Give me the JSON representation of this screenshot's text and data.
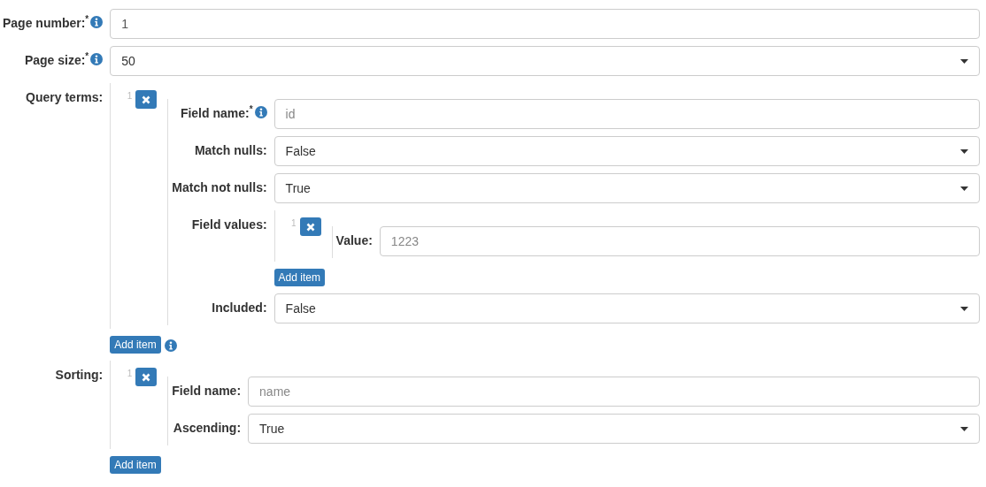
{
  "fields": [
    {
      "kind": "input",
      "label": "Page number:$^{*}$",
      "info": true,
      "value": "1"
    },
    {
      "kind": "select",
      "label": "Page size:$^{*}$",
      "info": true,
      "value": "50"
    },
    {
      "kind": "list",
      "label": "Query terms:",
      "add_button": "Add item",
      "add_info": true,
      "items": [
        {
          "index": "1",
          "fields": [
            {
              "kind": "input",
              "label": "Field name:$^{*}$",
              "info": true,
              "placeholder": "id"
            },
            {
              "kind": "select",
              "label": "Match nulls:",
              "value": "False"
            },
            {
              "kind": "select",
              "label": "Match not nulls:",
              "value": "True"
            },
            {
              "kind": "list",
              "label": "Field values:",
              "add_button": "Add item",
              "items": [
                {
                  "index": "1",
                  "fields": [
                    {
                      "kind": "input",
                      "label": "Value:",
                      "placeholder": "1223"
                    }
                  ]
                }
              ]
            },
            {
              "kind": "select",
              "label": "Included:",
              "value": "False"
            }
          ]
        }
      ]
    },
    {
      "kind": "list",
      "label": "Sorting:",
      "add_button": "Add item",
      "items": [
        {
          "index": "1",
          "fields": [
            {
              "kind": "input",
              "label": "Field name:",
              "placeholder": "name"
            },
            {
              "kind": "select",
              "label": "Ascending:",
              "value": "True"
            }
          ]
        }
      ]
    }
  ]
}
